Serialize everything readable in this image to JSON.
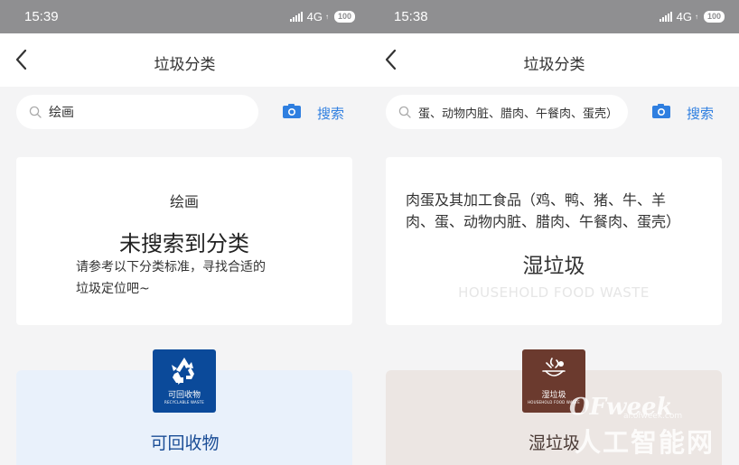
{
  "left": {
    "status": {
      "time": "15:39",
      "network": "4G",
      "battery": "100"
    },
    "nav": {
      "title": "垃圾分类"
    },
    "search": {
      "value": "绘画",
      "button": "搜索"
    },
    "result": {
      "query": "绘画",
      "heading": "未搜索到分类",
      "hint_line1": "请参考以下分类标准，寻找合适的",
      "hint_line2": "垃圾定位吧~"
    },
    "category": {
      "tile_cn": "可回收物",
      "tile_en": "RECYCLABLE WASTE",
      "label": "可回收物",
      "tile_color": "#0b4a9a",
      "panel_color": "#e9f1fb",
      "label_color": "#1a4d96"
    }
  },
  "right": {
    "status": {
      "time": "15:38",
      "network": "4G",
      "battery": "100"
    },
    "nav": {
      "title": "垃圾分类"
    },
    "search": {
      "value": "蛋、动物内脏、腊肉、午餐肉、蛋壳）",
      "button": "搜索"
    },
    "result": {
      "query_line1": "肉蛋及其加工食品（鸡、鸭、猪、牛、羊",
      "query_line2": "肉、蛋、动物内脏、腊肉、午餐肉、蛋壳）",
      "category_cn": "湿垃圾",
      "category_en": "HOUSEHOLD FOOD WASTE"
    },
    "category": {
      "tile_cn": "湿垃圾",
      "tile_en": "HOUSEHOLD FOOD WASTE",
      "label": "湿垃圾",
      "tile_color": "#6b3a2e",
      "panel_color": "#ece6e3",
      "label_color": "#4a3a35"
    }
  },
  "watermark": {
    "brand": "OFweek",
    "domain": "ai.ofweek.com",
    "name": "人工智能网"
  }
}
